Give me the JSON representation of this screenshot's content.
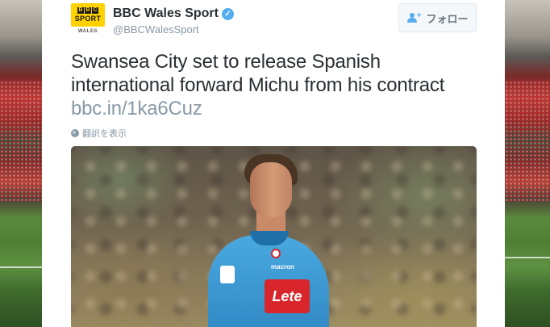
{
  "account": {
    "display_name": "BBC Wales Sport",
    "handle": "@BBCWalesSport",
    "avatar": {
      "bbc_letters": [
        "B",
        "B",
        "C"
      ],
      "sport_word": "SPORT",
      "region_word": "WALES"
    }
  },
  "follow_button": {
    "label": "フォロー",
    "icon": "add-user-icon"
  },
  "tweet": {
    "text": "Swansea City set to release Spanish international forward Michu from his contract ",
    "link": "bbc.in/1ka6Cuz"
  },
  "translate": {
    "icon": "globe-icon",
    "label": "翻訳を表示"
  },
  "photo": {
    "sponsor_text": "Lete",
    "maker_text": "macron"
  },
  "colors": {
    "link": "#8899a6",
    "verified": "#55acee",
    "follow_icon": "#55acee",
    "avatar_yellow": "#ffd200"
  }
}
